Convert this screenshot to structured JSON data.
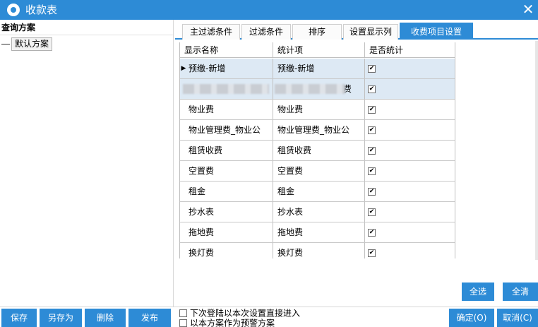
{
  "window": {
    "title": "收款表",
    "close_glyph": "✕"
  },
  "left": {
    "header": "查询方案",
    "tree_item": "默认方案",
    "buttons": {
      "save": "保存",
      "save_as": "另存为",
      "delete": "删除",
      "publish": "发布"
    }
  },
  "tabs": [
    {
      "label": "主过滤条件",
      "active": false
    },
    {
      "label": "过滤条件",
      "active": false
    },
    {
      "label": "排序",
      "active": false
    },
    {
      "label": "设置显示列",
      "active": false
    },
    {
      "label": "收费项目设置",
      "active": true
    }
  ],
  "grid": {
    "columns": [
      "显示名称",
      "统计项",
      "是否统计"
    ],
    "rows": [
      {
        "name": "预缴-新增",
        "stat": "预缴-新增",
        "checked": true,
        "selected": true,
        "current": true
      },
      {
        "name": "",
        "stat": "费",
        "checked": true,
        "selected": true,
        "redacted": true
      },
      {
        "name": "物业费",
        "stat": "物业费",
        "checked": true
      },
      {
        "name": "物业管理费_物业公",
        "stat": "物业管理费_物业公",
        "checked": true
      },
      {
        "name": "租赁收费",
        "stat": "租赁收费",
        "checked": true
      },
      {
        "name": "空置费",
        "stat": "空置费",
        "checked": true
      },
      {
        "name": "租金",
        "stat": "租金",
        "checked": true
      },
      {
        "name": "抄水表",
        "stat": "抄水表",
        "checked": true
      },
      {
        "name": "拖地费",
        "stat": "拖地费",
        "checked": true
      },
      {
        "name": "换灯费",
        "stat": "换灯费",
        "checked": true
      }
    ]
  },
  "actions": {
    "select_all": "全选",
    "clear_all": "全清",
    "ok": "确定(O)",
    "cancel": "取消(C)"
  },
  "options": {
    "enter_directly": {
      "label": "下次登陆以本次设置直接进入",
      "checked": false
    },
    "as_alert": {
      "label": "以本方案作为预警方案",
      "checked": false
    }
  },
  "colors": {
    "accent": "#2d8bd6",
    "selected_row": "#dde9f4"
  }
}
